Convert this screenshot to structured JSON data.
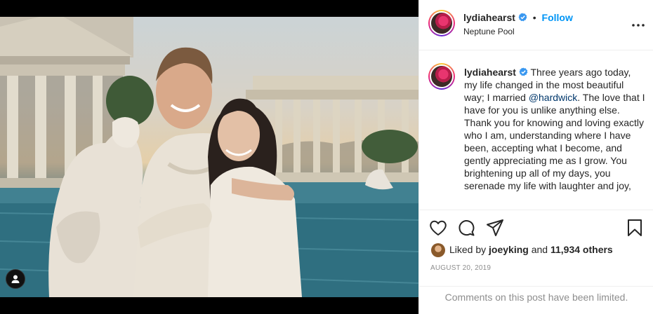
{
  "post": {
    "username": "lydiahearst",
    "follow_label": "Follow",
    "separator": "•",
    "location": "Neptune Pool",
    "caption": {
      "username": "lydiahearst",
      "text_before": "Three years ago today, my life changed in the most beautiful way; I married ",
      "mention": "@hardwick",
      "text_after": ". The love that I have for you is unlike anything else. Thank you for knowing and loving exactly who I am, understanding where I have been, accepting what I become, and gently appreciating me as I grow. You brightening up all of my days, you serenade my life with laughter and joy,"
    },
    "likes": {
      "prefix": "Liked by ",
      "liker": "joeyking",
      "middle": " and ",
      "count": "11,934 others"
    },
    "date": "AUGUST 20, 2019",
    "comments_limited": "Comments on this post have been limited."
  },
  "icons": {
    "verified": "verified-badge-icon",
    "more": "more-options-icon",
    "like": "heart-icon",
    "comment": "comment-bubble-icon",
    "share": "paper-plane-icon",
    "save": "bookmark-icon",
    "user_tag": "user-tag-icon"
  },
  "colors": {
    "link_blue": "#0095f6",
    "mention_blue": "#00376b",
    "verified_blue": "#3897f0",
    "muted_gray": "#8e8e8e",
    "border": "#efefef"
  }
}
